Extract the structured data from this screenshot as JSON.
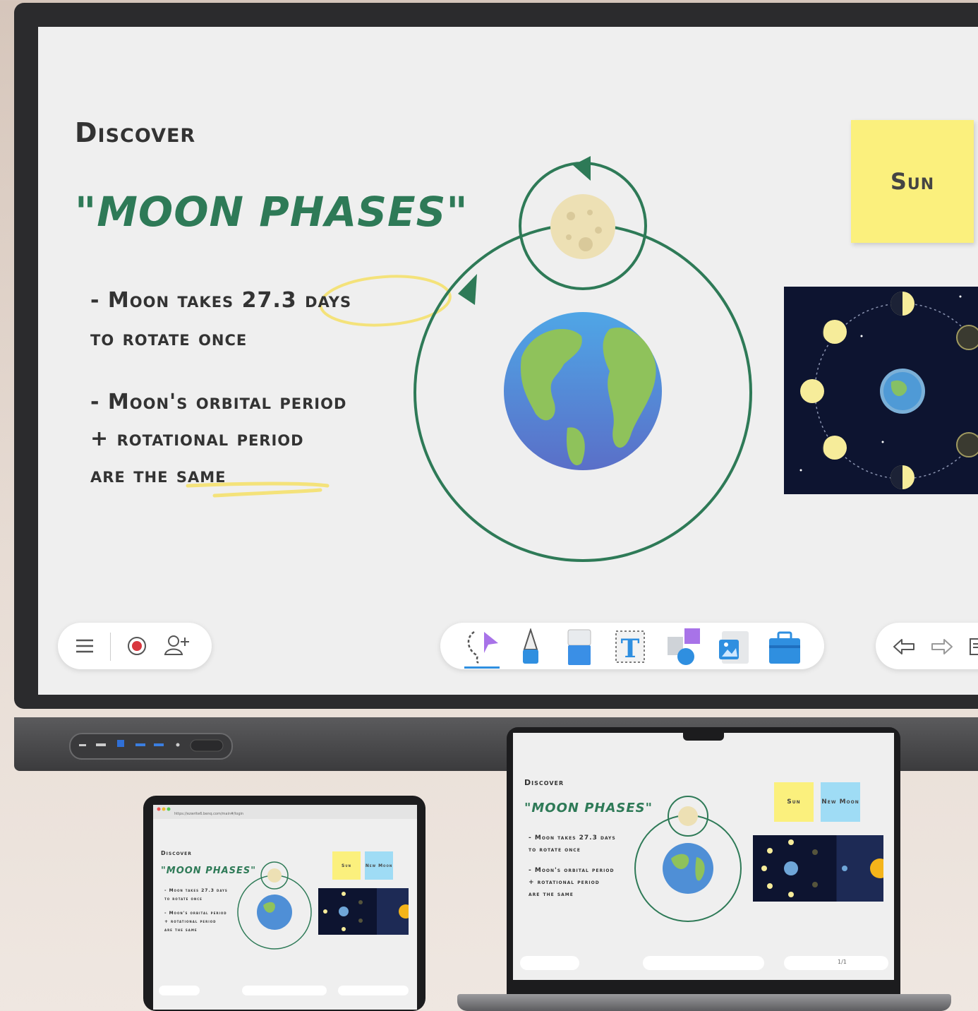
{
  "board": {
    "heading": "Discover",
    "title": "\"MOON PHASES\"",
    "bullet1_line1": "- Moon takes 27.3 days",
    "bullet1_line2": "to rotate once",
    "bullet2_line1": "- Moon's orbital period",
    "bullet2_line2": "+ rotational period",
    "bullet2_line3": "are the same",
    "sticky_sun": "Sun",
    "sticky_new_moon": "New Moon"
  },
  "toolbar": {
    "tools": [
      "select-tool",
      "pen-tool",
      "eraser-tool",
      "text-tool",
      "shapes-tool",
      "image-tool",
      "toolbox-tool"
    ],
    "page_indicator": "1/1"
  },
  "colors": {
    "accent_green": "#2e7a57",
    "sticky_yellow": "#fbf07d",
    "sticky_blue": "#9fdcf5",
    "board_bg": "#efefef",
    "record_red": "#d9363e",
    "tool_blue": "#2f8fe0"
  },
  "tablet": {
    "url": "https://ezwrite6.benq.com/main#/login"
  }
}
